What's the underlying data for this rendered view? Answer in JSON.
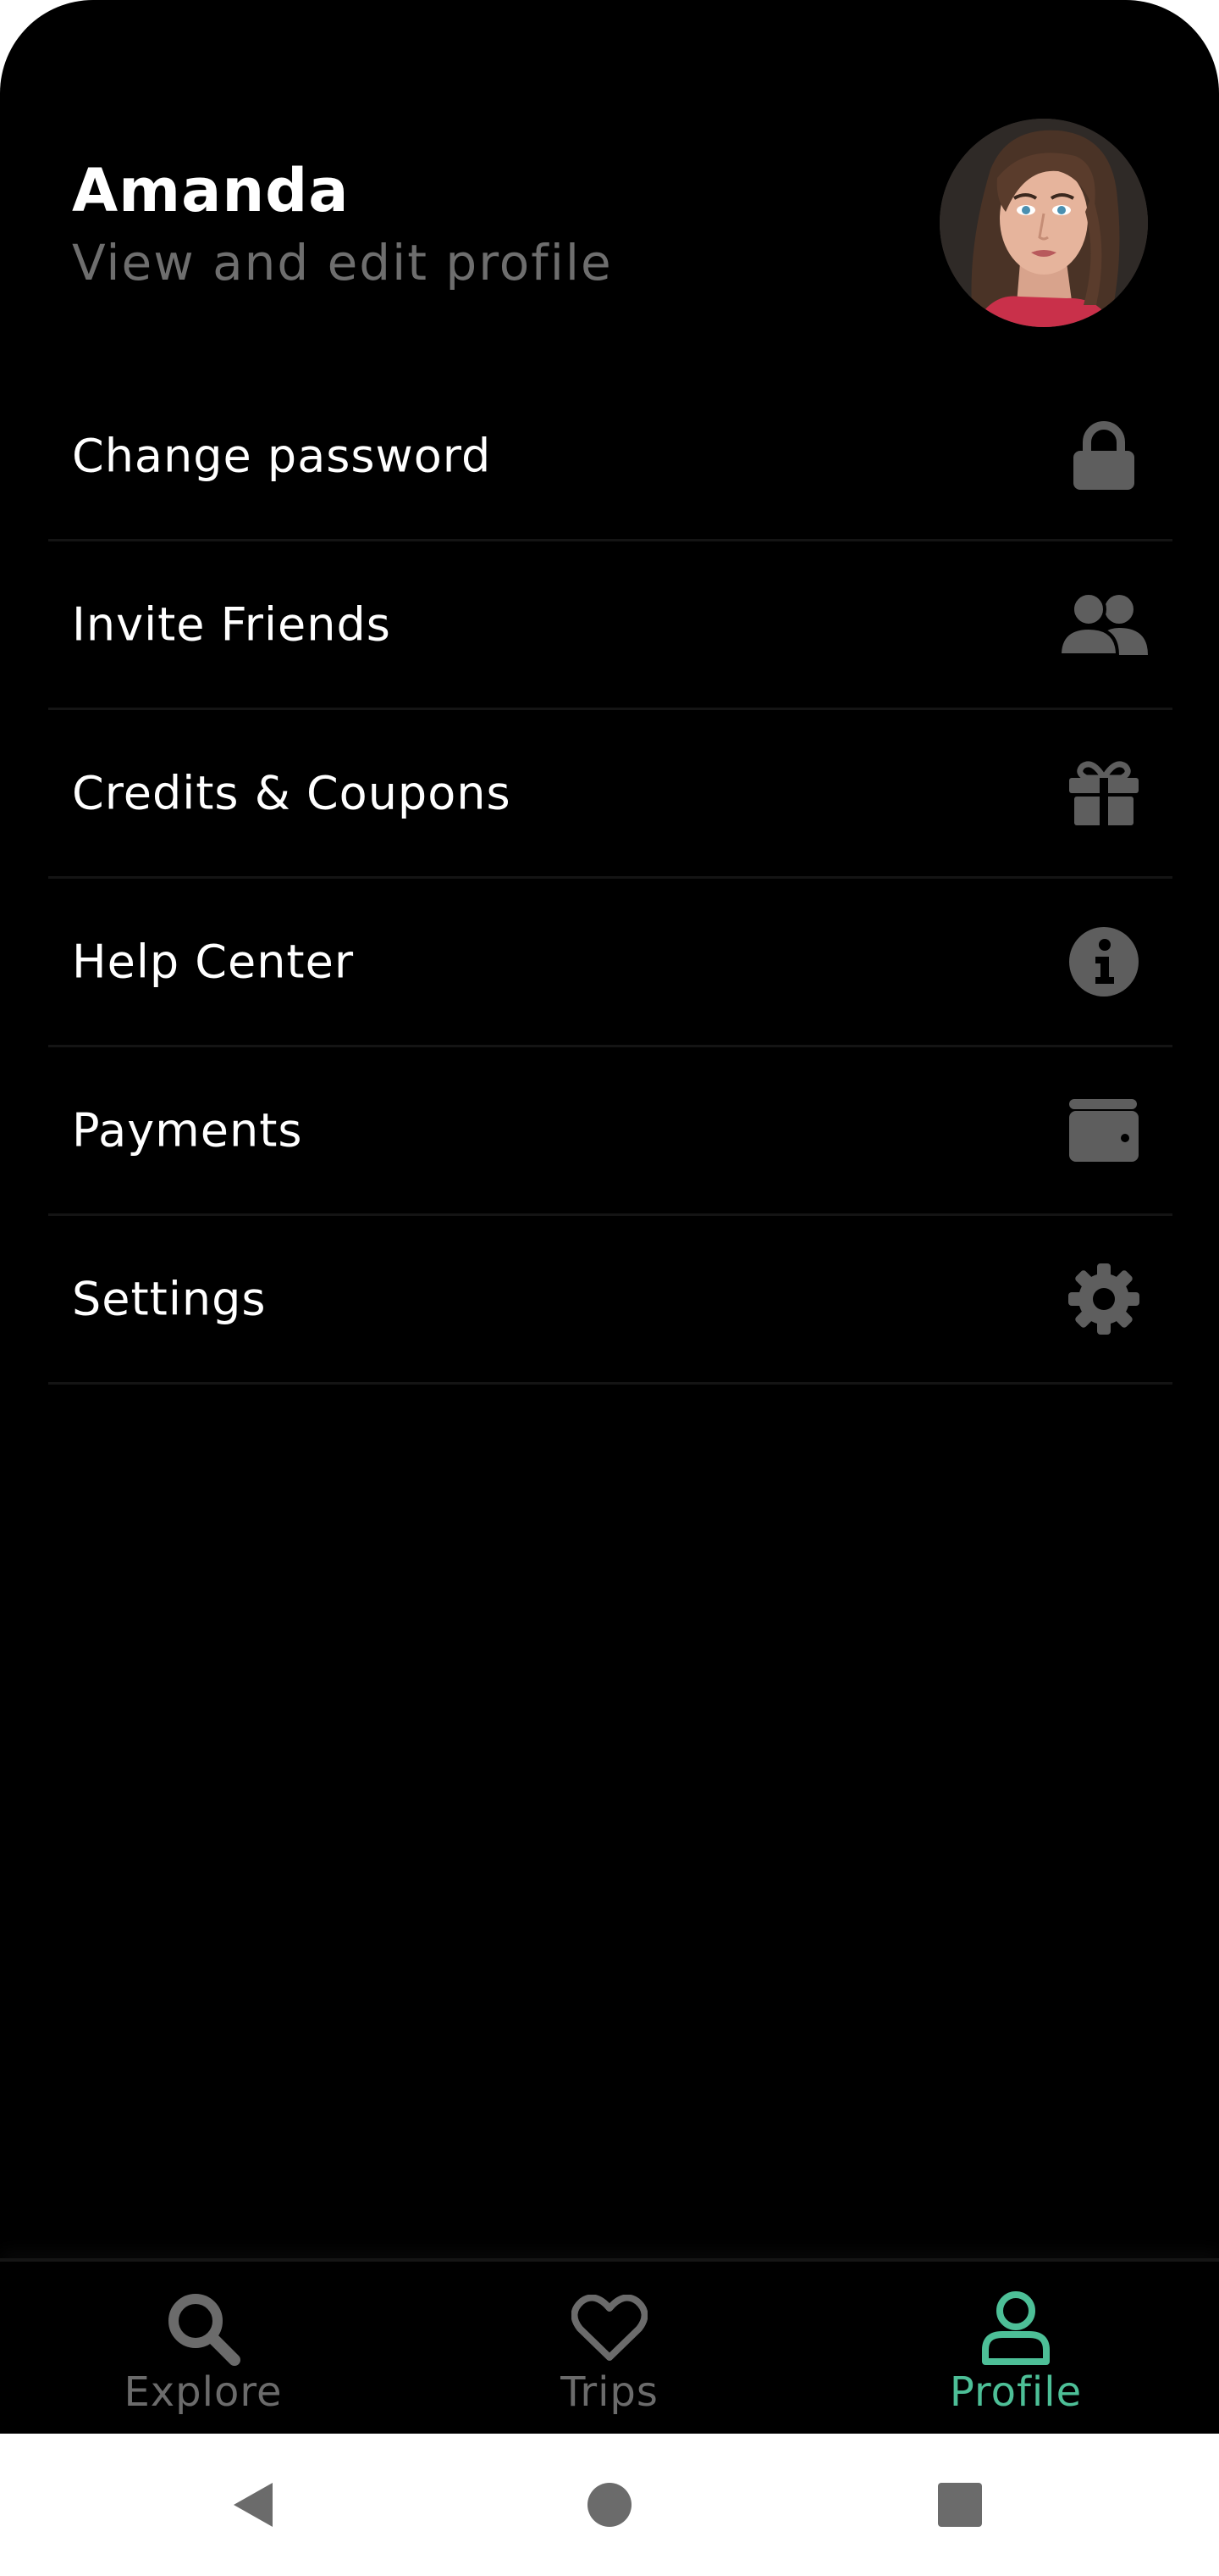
{
  "profile": {
    "name": "Amanda",
    "subtitle": "View and edit profile",
    "avatar_icon": "user-avatar-photo"
  },
  "menu": {
    "items": [
      {
        "label": "Change password",
        "icon": "lock-icon"
      },
      {
        "label": "Invite Friends",
        "icon": "users-icon"
      },
      {
        "label": "Credits & Coupons",
        "icon": "gift-icon"
      },
      {
        "label": "Help Center",
        "icon": "info-icon"
      },
      {
        "label": "Payments",
        "icon": "wallet-icon"
      },
      {
        "label": "Settings",
        "icon": "gear-icon"
      }
    ],
    "icon_color": "#5e5e5e"
  },
  "tabbar": {
    "tabs": [
      {
        "label": "Explore",
        "icon": "search-icon",
        "active": false
      },
      {
        "label": "Trips",
        "icon": "heart-icon",
        "active": false
      },
      {
        "label": "Profile",
        "icon": "user-icon",
        "active": true
      }
    ],
    "active_color": "#4dbf97",
    "inactive_color": "#6b6b6b"
  },
  "system_nav": {
    "buttons": [
      "back-icon",
      "home-icon",
      "recents-icon"
    ],
    "color": "#6b6b6b"
  }
}
